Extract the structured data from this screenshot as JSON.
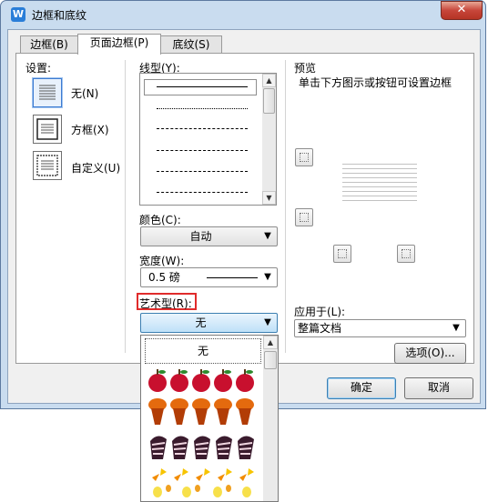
{
  "window": {
    "title": "边框和底纹",
    "app_icon": "W",
    "close_label": "✕"
  },
  "tabs": [
    {
      "label": "边框(B)"
    },
    {
      "label": "页面边框(P)"
    },
    {
      "label": "底纹(S)"
    }
  ],
  "settings": {
    "label": "设置:",
    "items": [
      {
        "label": "无(N)",
        "icon": "no-border-icon"
      },
      {
        "label": "方框(X)",
        "icon": "box-border-icon"
      },
      {
        "label": "自定义(U)",
        "icon": "custom-border-icon"
      }
    ]
  },
  "line_style": {
    "label": "线型(Y):"
  },
  "color": {
    "label": "颜色(C):",
    "value": "自动"
  },
  "width": {
    "label": "宽度(W):",
    "value": "0.5 磅"
  },
  "art": {
    "label": "艺术型(R):",
    "value": "无",
    "options": [
      "无",
      "apple-border-icon",
      "cupcake-border-icon",
      "cake-slice-border-icon",
      "candy-corn-border-icon",
      "candle-border-icon"
    ]
  },
  "preview": {
    "label": "预览",
    "hint": "单击下方图示或按钮可设置边框"
  },
  "apply_to": {
    "label": "应用于(L):",
    "value": "整篇文档"
  },
  "buttons": {
    "options": "选项(O)...",
    "ok": "确定",
    "cancel": "取消"
  },
  "colors": {
    "accent": "#3c7fb1",
    "highlight": "#e02b2b"
  }
}
